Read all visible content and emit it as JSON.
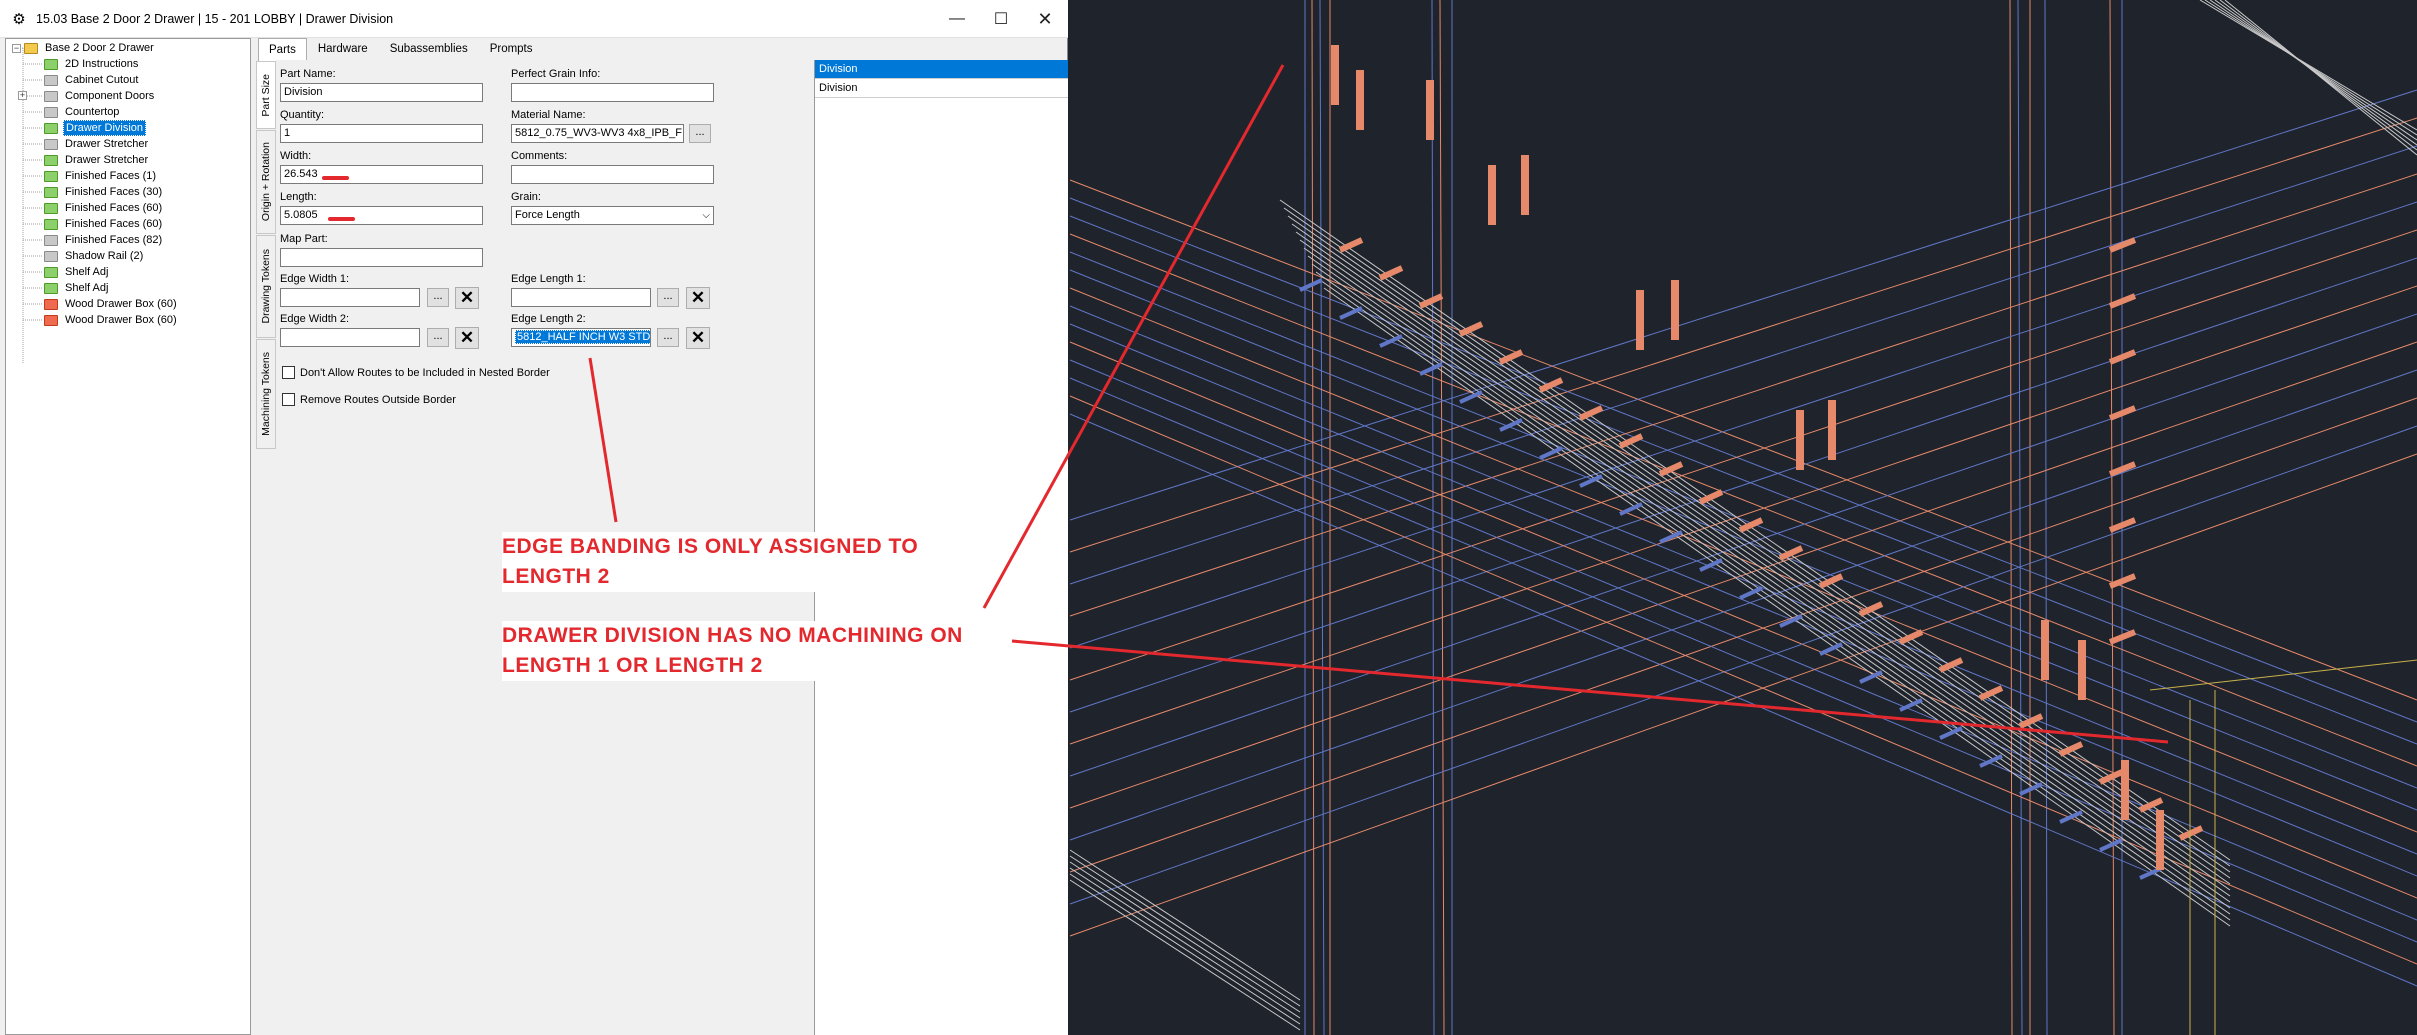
{
  "window": {
    "title": "15.03 Base 2 Door 2 Drawer | 15 - 201 LOBBY | Drawer Division",
    "minimize": "—",
    "maximize": "☐",
    "close": "✕"
  },
  "tree": {
    "root": "Base 2 Door 2 Drawer",
    "items": [
      {
        "label": "2D Instructions",
        "color": "green"
      },
      {
        "label": "Cabinet Cutout",
        "color": "gray"
      },
      {
        "label": "Component Doors",
        "color": "gray",
        "expandable": true
      },
      {
        "label": "Countertop",
        "color": "gray"
      },
      {
        "label": "Drawer Division",
        "color": "green",
        "selected": true
      },
      {
        "label": "Drawer Stretcher",
        "color": "gray"
      },
      {
        "label": "Drawer Stretcher",
        "color": "green"
      },
      {
        "label": "Finished Faces (1)",
        "color": "green"
      },
      {
        "label": "Finished Faces (30)",
        "color": "green"
      },
      {
        "label": "Finished Faces (60)",
        "color": "green"
      },
      {
        "label": "Finished Faces (60)",
        "color": "green"
      },
      {
        "label": "Finished Faces (82)",
        "color": "gray"
      },
      {
        "label": "Shadow Rail (2)",
        "color": "gray"
      },
      {
        "label": "Shelf Adj",
        "color": "green"
      },
      {
        "label": "Shelf Adj",
        "color": "green"
      },
      {
        "label": "Wood Drawer Box (60)",
        "color": "red"
      },
      {
        "label": "Wood Drawer Box (60)",
        "color": "red"
      }
    ]
  },
  "tabs": [
    "Parts",
    "Hardware",
    "Subassemblies",
    "Prompts"
  ],
  "vtabs": [
    "Part Size",
    "Origin + Rotation",
    "Drawing Tokens",
    "Machining Tokens"
  ],
  "form": {
    "part_name_label": "Part Name:",
    "part_name": "Division",
    "perfect_grain_label": "Perfect Grain Info:",
    "perfect_grain": "",
    "quantity_label": "Quantity:",
    "quantity": "1",
    "material_name_label": "Material Name:",
    "material_name": "5812_0.75_WV3-WV3 4x8_IPB_F",
    "width_label": "Width:",
    "width": "26.543",
    "comments_label": "Comments:",
    "comments": "",
    "length_label": "Length:",
    "length": "5.0805",
    "grain_label": "Grain:",
    "grain": "Force Length",
    "map_part_label": "Map Part:",
    "map_part": "",
    "edge_width1_label": "Edge Width 1:",
    "edge_width1": "",
    "edge_length1_label": "Edge Length 1:",
    "edge_length1": "",
    "edge_width2_label": "Edge  Width 2:",
    "edge_width2": "",
    "edge_length2_label": "Edge Length 2:",
    "edge_length2": "5812_HALF INCH W3 STD",
    "browse": "...",
    "clear": "✕",
    "check1": "Don't Allow Routes to be Included in Nested Border",
    "check2": "Remove Routes Outside Border"
  },
  "list": [
    "Division",
    "Division"
  ],
  "annotations": {
    "note1": "EDGE BANDING IS ONLY ASSIGNED TO\nLENGTH 2",
    "note2": "DRAWER DIVISION HAS NO MACHINING ON\nLENGTH 1 OR LENGTH 2"
  },
  "colors": {
    "accent": "#0078d7",
    "annotation": "#e3282e",
    "cad_background": "#1f232b",
    "folder_green": "#8dcf6a",
    "folder_gray": "#c8c8c8",
    "folder_red": "#ef6b4f"
  }
}
